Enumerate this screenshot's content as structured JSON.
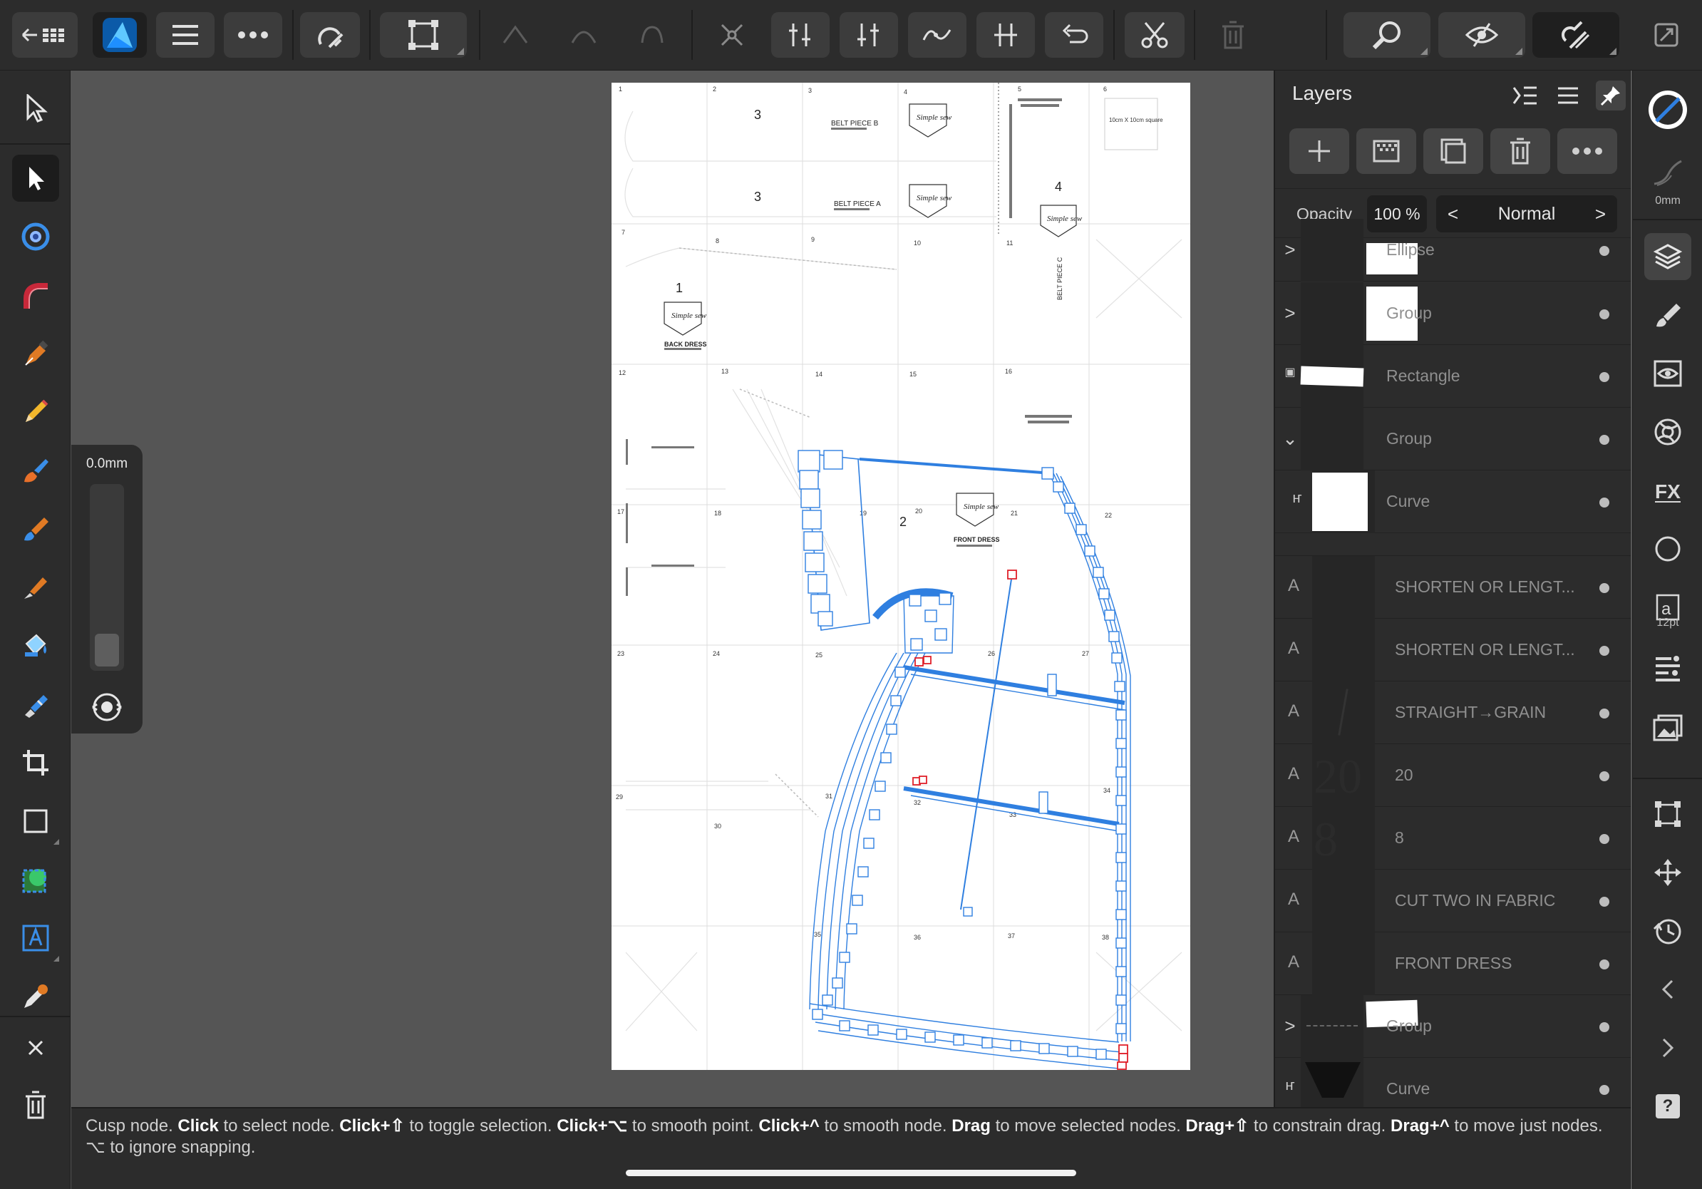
{
  "toolbar": {
    "back_icon": "back-grid-icon",
    "app_icon": "affinity-designer-icon",
    "buttons": [
      "menu-icon",
      "more-icon",
      "snapping-icon",
      "transform-icon",
      "convert-icon",
      "node-icon",
      "action-icon",
      "zoom-icon",
      "view-mode-icon",
      "assistant-icon",
      "fullscreen-icon"
    ]
  },
  "tools": {
    "width_popup_value": "0.0mm"
  },
  "document": {
    "page_numbers": [
      "1",
      "2",
      "3",
      "4",
      "5",
      "6",
      "7",
      "8",
      "9",
      "10",
      "11",
      "12",
      "13",
      "14",
      "15",
      "16",
      "17",
      "18",
      "19",
      "20",
      "21",
      "22",
      "23",
      "24",
      "25",
      "26",
      "27",
      "29",
      "30",
      "31",
      "32",
      "33",
      "34",
      "35",
      "36",
      "37",
      "38"
    ],
    "labels": {
      "belt_b": "BELT PIECE B",
      "belt_a": "BELT PIECE A",
      "belt_c": "BELT PIECE C",
      "back_dress": "BACK DRESS",
      "front_dress": "FRONT DRESS",
      "square": "10cm X 10cm square",
      "num_3": "3",
      "num_1": "1",
      "num_2": "2",
      "num_4": "4",
      "logo": "Simple sew"
    }
  },
  "layers_panel": {
    "title": "Layers",
    "opacity_label": "Opacity",
    "opacity_value": "100 %",
    "blend_mode": "Normal",
    "rows": [
      {
        "name": "Ellipse",
        "kind": "ellipse",
        "expand": ">"
      },
      {
        "name": "Group",
        "kind": "group",
        "expand": ">"
      },
      {
        "name": "Rectangle",
        "kind": "rectangle",
        "expand": ""
      },
      {
        "name": "Group",
        "kind": "group",
        "expand": "v"
      },
      {
        "name": "Curve",
        "kind": "curve",
        "expand": ""
      },
      {
        "name": "SHORTEN OR LENGT...",
        "kind": "text",
        "glyph": "A"
      },
      {
        "name": "SHORTEN OR LENGT...",
        "kind": "text",
        "glyph": "A"
      },
      {
        "name": "STRAIGHT→GRAIN",
        "kind": "text",
        "glyph": "A"
      },
      {
        "name": "20",
        "kind": "text",
        "glyph": "A",
        "preview": "20"
      },
      {
        "name": "8",
        "kind": "text",
        "glyph": "A",
        "preview": "8"
      },
      {
        "name": "CUT TWO IN FABRIC",
        "kind": "text",
        "glyph": "A"
      },
      {
        "name": "FRONT DRESS",
        "kind": "text",
        "glyph": "A"
      },
      {
        "name": "Group",
        "kind": "group",
        "expand": ">"
      },
      {
        "name": "Curve",
        "kind": "curve",
        "expand": ""
      }
    ]
  },
  "studio": {
    "stroke_label": "0mm",
    "text_size_label": "12pt",
    "help_label": "?"
  },
  "status": {
    "hint": "Cusp node. Click to select node. Click+⇧ to toggle selection. Click+⌥ to smooth point. Click+^ to smooth node. Drag to move selected nodes. Drag+⇧ to constrain drag. Drag+^ to move just nodes. ⌥ to ignore snapping."
  },
  "colors": {
    "ui_bg": "#2c2c2c",
    "canvas_bg": "#555555",
    "selection_blue": "#2f7fe0",
    "node_red": "#e0202a",
    "tool_active_bg": "#1c1c1c"
  }
}
